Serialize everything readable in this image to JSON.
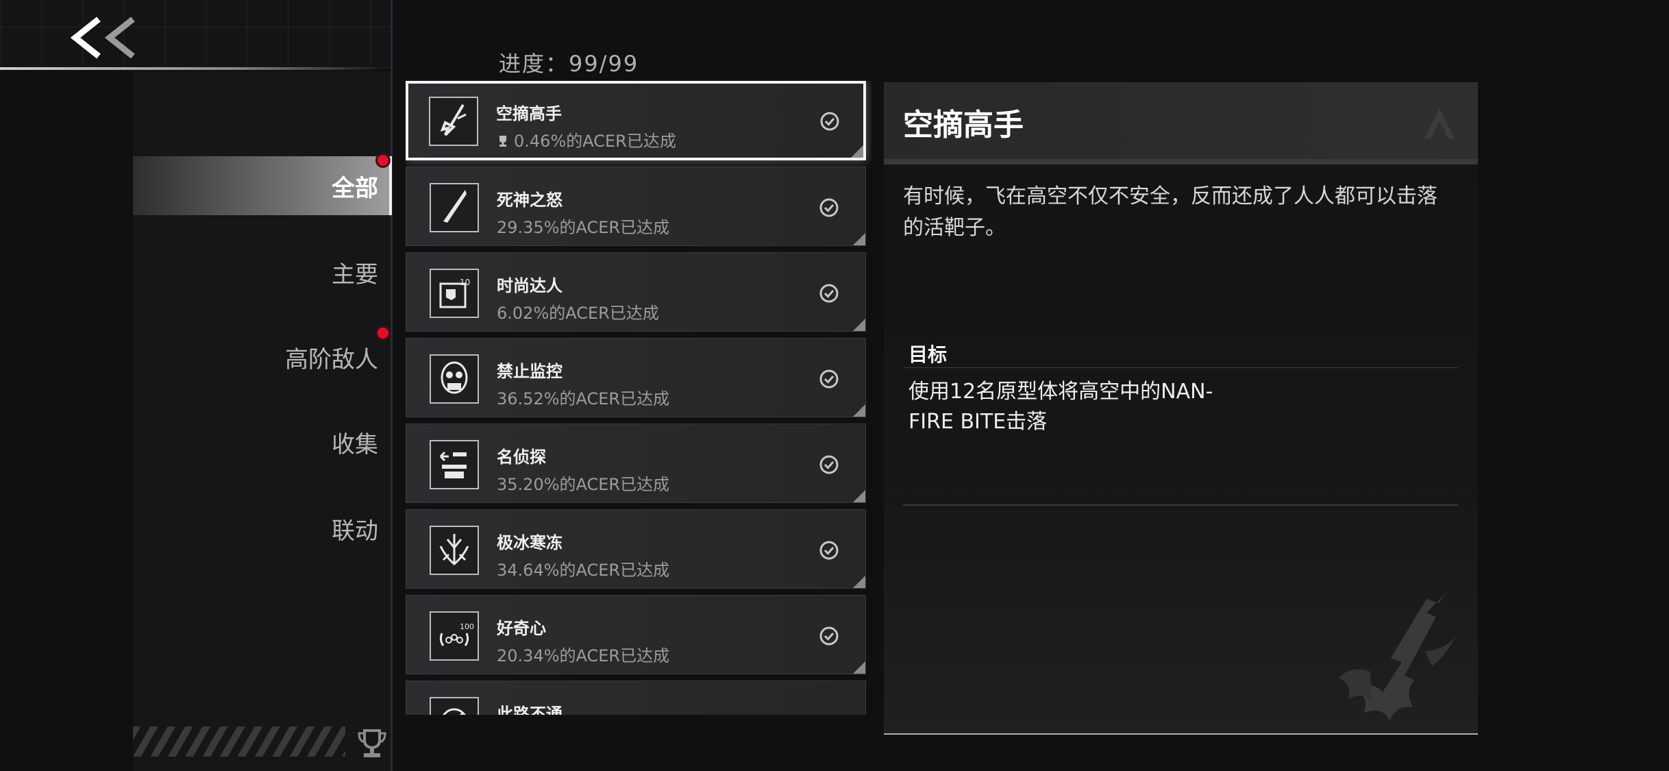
{
  "nav": {
    "back_icon": "double-chevron-left-icon"
  },
  "categories": [
    {
      "label": "全部",
      "active": true,
      "badge": true
    },
    {
      "label": "主要",
      "active": false,
      "badge": false
    },
    {
      "label": "高阶敌人",
      "active": false,
      "badge": true
    },
    {
      "label": "收集",
      "active": false,
      "badge": false
    },
    {
      "label": "联动",
      "active": false,
      "badge": false
    }
  ],
  "footer": {
    "trophy_icon": "trophy-icon"
  },
  "progress": {
    "text": "进度：99/99"
  },
  "achievements": [
    {
      "title": "空摘高手",
      "rate": "0.46%的ACER已达成",
      "selected": true,
      "icon": "sword-icon",
      "rate_icon": "trophy-icon"
    },
    {
      "title": "死神之怒",
      "rate": "29.35%的ACER已达成",
      "icon": "blade-icon"
    },
    {
      "title": "时尚达人",
      "rate": "6.02%的ACER已达成",
      "icon": "outfit-icon"
    },
    {
      "title": "禁止监控",
      "rate": "36.52%的ACER已达成",
      "icon": "mask-icon"
    },
    {
      "title": "名侦探",
      "rate": "35.20%的ACER已达成",
      "icon": "detective-icon"
    },
    {
      "title": "极冰寒冻",
      "rate": "34.64%的ACER已达成",
      "icon": "ice-icon"
    },
    {
      "title": "好奇心",
      "rate": "20.34%的ACER已达成",
      "icon": "curiosity-icon"
    },
    {
      "title": "此路不通",
      "rate": "",
      "icon": "blocked-icon"
    }
  ],
  "detail": {
    "title": "空摘高手",
    "description": "有时候，飞在高空不仅不安全，反而还成了人人都可以击落的活靶子。",
    "goal_label": "目标",
    "goal_line1": "使用12名原型体将高空中的NAN-",
    "goal_line2": "FIRE BITE击落"
  },
  "colors": {
    "badge": "#e0102a",
    "selected_border": "#f4f4f4",
    "background": "#101012"
  }
}
